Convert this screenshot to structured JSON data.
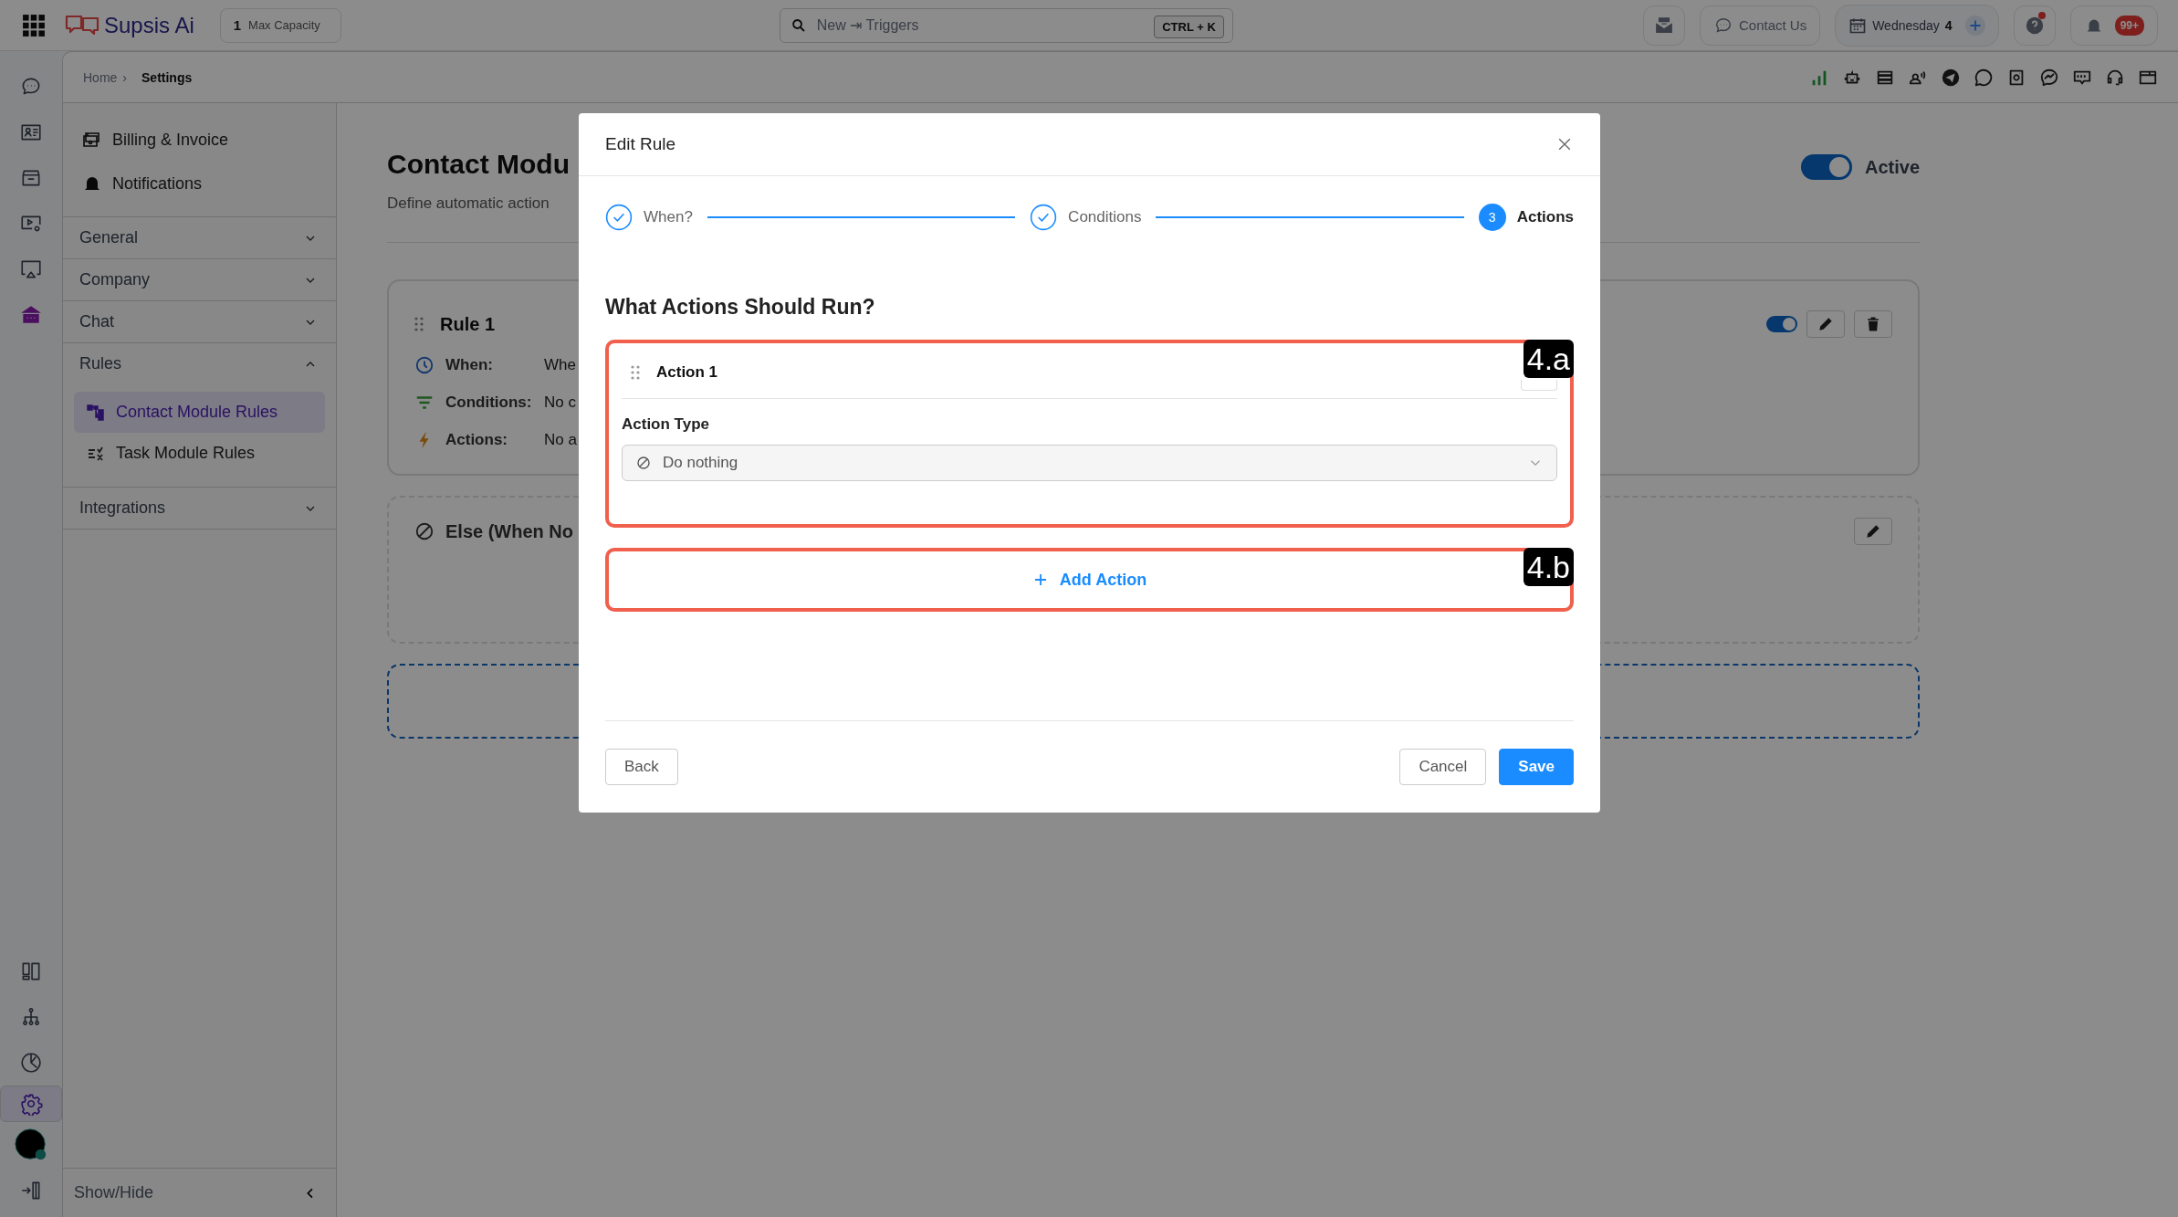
{
  "top_bar": {
    "logo": "Supsis Ai",
    "capacity": {
      "count": "1",
      "label": "Max Capacity"
    },
    "search": {
      "placeholder": "New ⇥ Triggers",
      "shortcut": "CTRL + K"
    },
    "contact_button": "Contact Us",
    "date": {
      "day": "Wednesday",
      "number": "4"
    },
    "help_has_alert": true,
    "notifications_badge": "99+"
  },
  "rail": {
    "top": [
      {
        "kind": "chat",
        "selected": false
      },
      {
        "kind": "contacts",
        "selected": false
      },
      {
        "kind": "inbox",
        "selected": false
      },
      {
        "kind": "video",
        "selected": false
      },
      {
        "kind": "monitor",
        "selected": false
      },
      {
        "kind": "home",
        "selected": false
      }
    ],
    "bottom": [
      {
        "kind": "layout",
        "selected": false
      },
      {
        "kind": "tree",
        "selected": false
      },
      {
        "kind": "pie",
        "selected": false
      },
      {
        "kind": "gear",
        "selected": true
      },
      {
        "kind": "avatar",
        "selected": false
      },
      {
        "kind": "exit",
        "selected": false
      }
    ]
  },
  "breadcrumb": {
    "items": [
      "Home",
      "Settings"
    ],
    "separator": "›"
  },
  "channels": [
    {
      "kind": "signal"
    },
    {
      "kind": "robot"
    },
    {
      "kind": "server"
    },
    {
      "kind": "users"
    },
    {
      "kind": "plane"
    },
    {
      "kind": "phone"
    },
    {
      "kind": "camera"
    },
    {
      "kind": "messenger"
    },
    {
      "kind": "sms"
    },
    {
      "kind": "headset"
    },
    {
      "kind": "window"
    }
  ],
  "settings_nav": {
    "items": [
      {
        "label": "Billing & Invoice",
        "kind": "billing"
      },
      {
        "label": "Notifications",
        "kind": "bell"
      }
    ],
    "sections": [
      {
        "label": "General",
        "expanded": false
      },
      {
        "label": "Company",
        "expanded": false
      },
      {
        "label": "Chat",
        "expanded": false
      },
      {
        "label": "Rules",
        "expanded": true,
        "children": [
          {
            "label": "Contact Module Rules",
            "kind": "tree",
            "selected": true
          },
          {
            "label": "Task Module Rules",
            "kind": "tasks",
            "selected": false
          }
        ]
      },
      {
        "label": "Integrations",
        "expanded": false
      }
    ],
    "show_hide": "Show/Hide"
  },
  "page": {
    "title": "Contact Modu",
    "subtitle": "Define automatic action",
    "active": {
      "on": true,
      "label": "Active"
    },
    "rules": [
      {
        "name": "Rule 1",
        "on": true,
        "rows": [
          {
            "kind": "when",
            "label": "When:",
            "value": "Whe"
          },
          {
            "kind": "conditions",
            "label": "Conditions:",
            "value": "No c"
          },
          {
            "kind": "actions",
            "label": "Actions:",
            "value": "No a"
          }
        ]
      }
    ],
    "else_card": {
      "title": "Else (When No"
    }
  },
  "modal": {
    "title": "Edit Rule",
    "steps": [
      {
        "label": "When?",
        "completed": true,
        "selected": false
      },
      {
        "label": "Conditions",
        "completed": true,
        "selected": false
      },
      {
        "label": "Actions",
        "number": "3",
        "completed": false,
        "selected": true
      }
    ],
    "heading": "What Actions Should Run?",
    "actions": [
      {
        "title": "Action 1",
        "type_label": "Action Type",
        "type_value": "Do nothing",
        "annotation": "4.a"
      }
    ],
    "add_action": {
      "label": "Add Action",
      "annotation": "4.b"
    },
    "buttons": {
      "back": "Back",
      "cancel": "Cancel",
      "save": "Save"
    }
  }
}
